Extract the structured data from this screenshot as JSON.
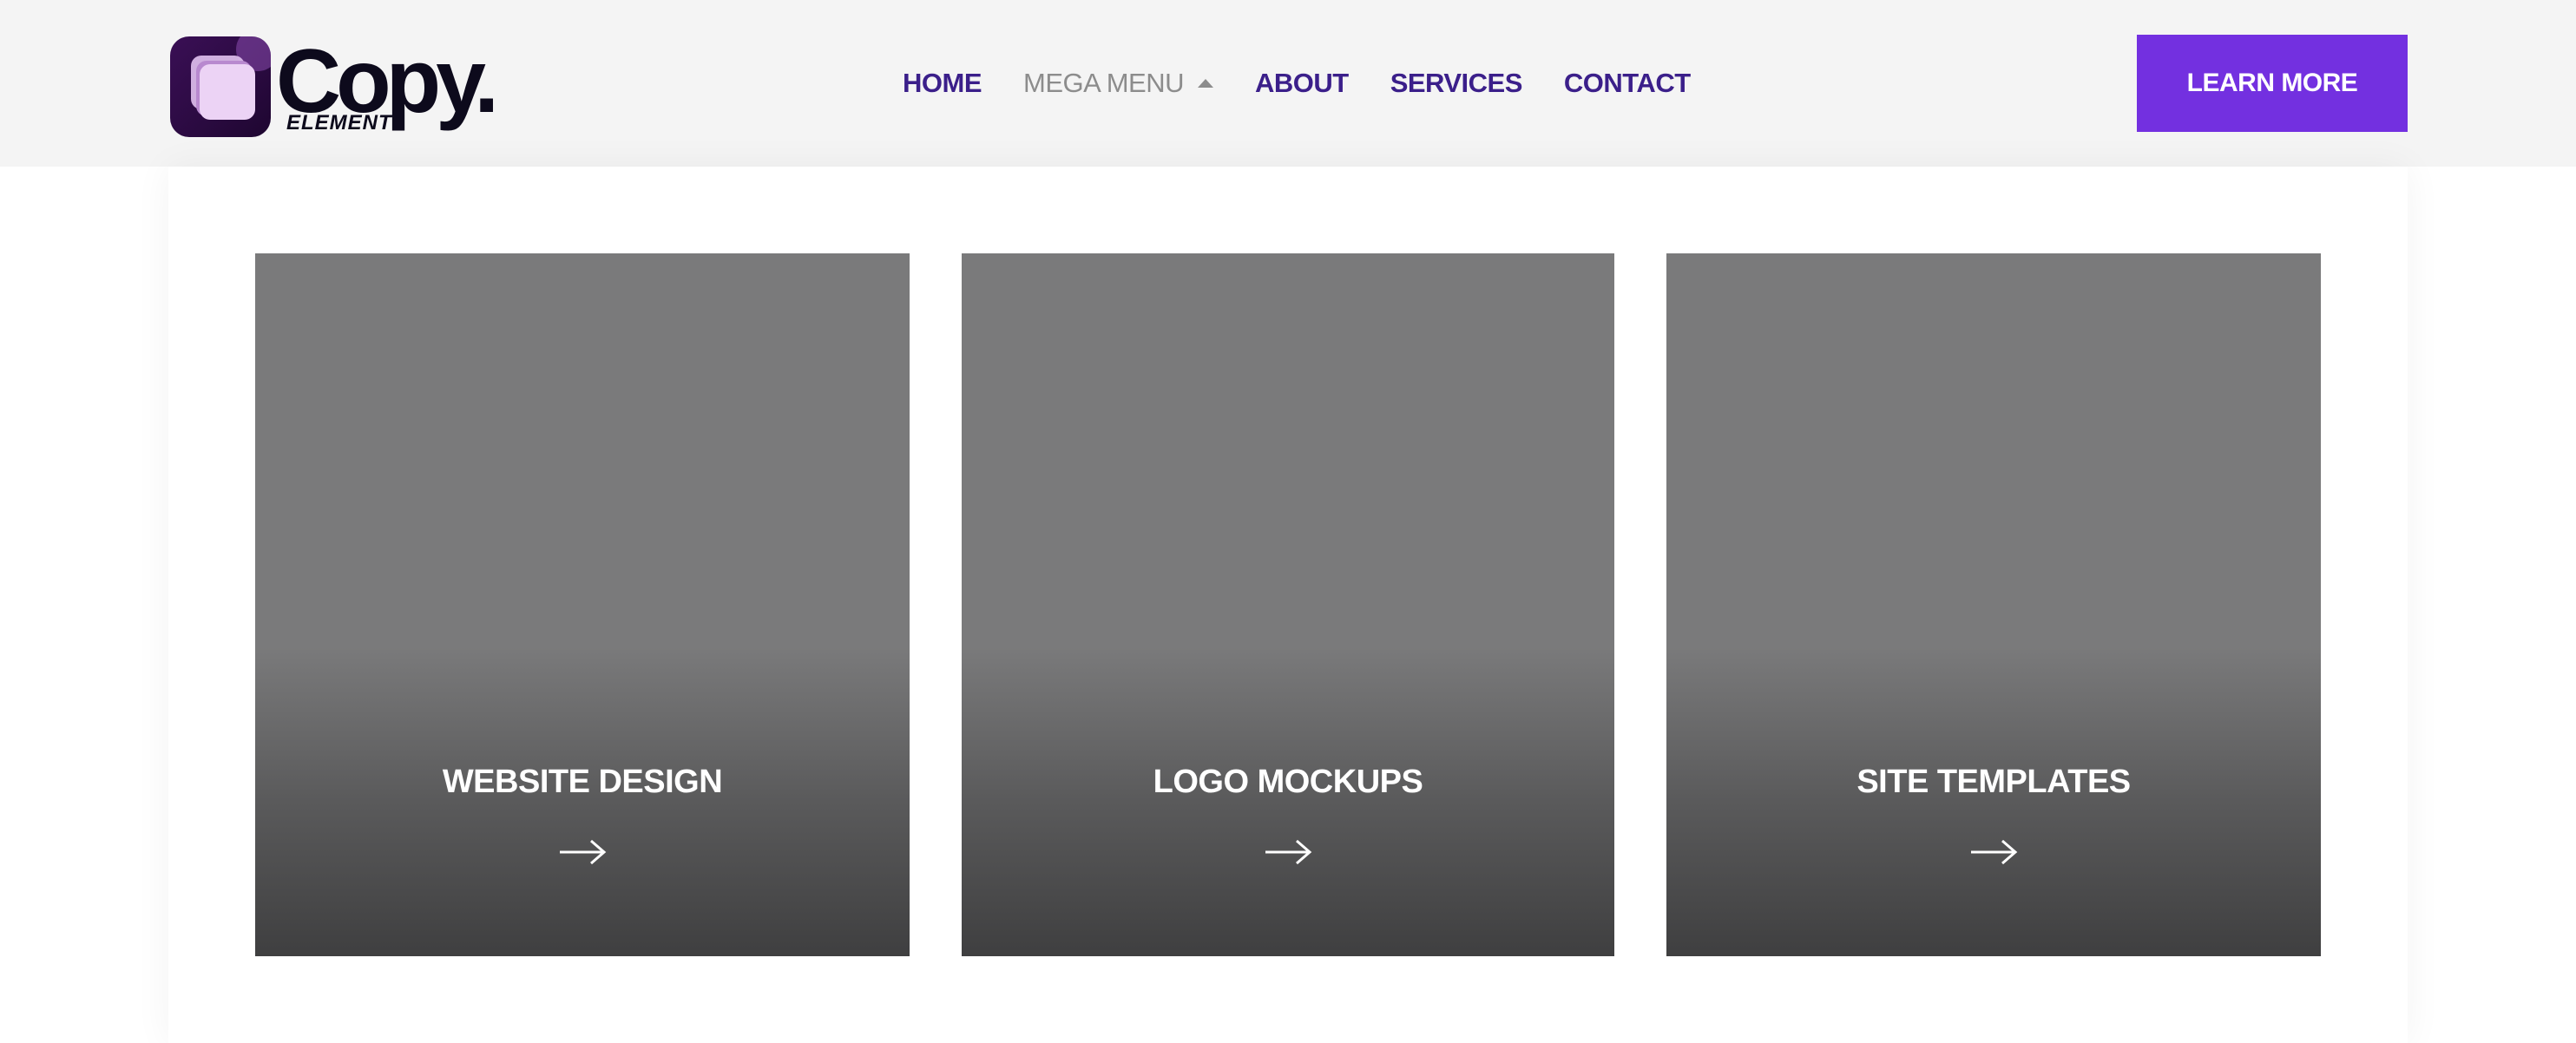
{
  "brand": {
    "name": "Copy.",
    "tagline": "ELEMENT",
    "logo_icon": "layered-squares-logo"
  },
  "nav": {
    "items": [
      {
        "label": "HOME"
      },
      {
        "label": "MEGA MENU",
        "icon": "caret-up-icon"
      },
      {
        "label": "ABOUT"
      },
      {
        "label": "SERVICES"
      },
      {
        "label": "CONTACT"
      }
    ]
  },
  "cta": {
    "label": "LEARN MORE"
  },
  "cards": [
    {
      "title": "WEBSITE DESIGN",
      "icon": "arrow-right-icon"
    },
    {
      "title": "LOGO MOCKUPS",
      "icon": "arrow-right-icon"
    },
    {
      "title": "SITE TEMPLATES",
      "icon": "arrow-right-icon"
    }
  ],
  "colors": {
    "accent": "#7330e0",
    "nav_text": "#3b1f8a",
    "nav_muted": "#8c8c8c",
    "header_bg": "#f4f4f4",
    "card_gray": "#7a7a7b"
  }
}
